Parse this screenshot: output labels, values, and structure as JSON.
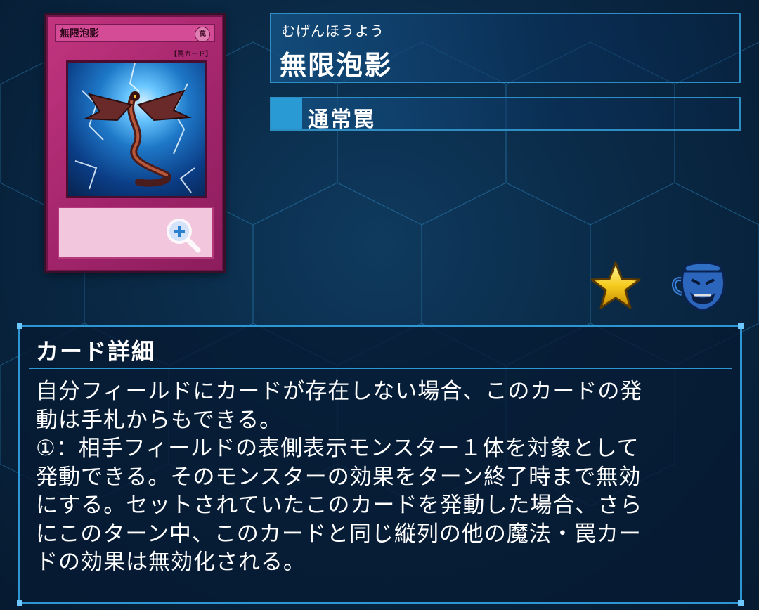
{
  "card": {
    "image_name": "無限泡影",
    "image_type_label": "【罠カード】",
    "attribute_glyph": "罠",
    "colors": {
      "frame": "#b22d74",
      "text_box": "#f2c7de",
      "art_bg": "#1e78c8"
    }
  },
  "header": {
    "ruby": "むげんほうよう",
    "name": "無限泡影",
    "type": "通常罠",
    "accent": "#2e8ec4"
  },
  "icons": {
    "zoom": "zoom-in-icon",
    "rarity": "star-icon",
    "pot": "pot-of-greed-icon"
  },
  "detail": {
    "title": "カード詳細",
    "lines": [
      "自分フィールドにカードが存在しない場合、このカードの発",
      "動は手札からもできる。",
      "①：相手フィールドの表側表示モンスター１体を対象として",
      "発動できる。そのモンスターの効果をターン終了時まで無効",
      "にする。セットされていたこのカードを発動した場合、さら",
      "にこのターン中、このカードと同じ縦列の他の魔法・罠カー",
      "ドの効果は無効化される。"
    ]
  }
}
